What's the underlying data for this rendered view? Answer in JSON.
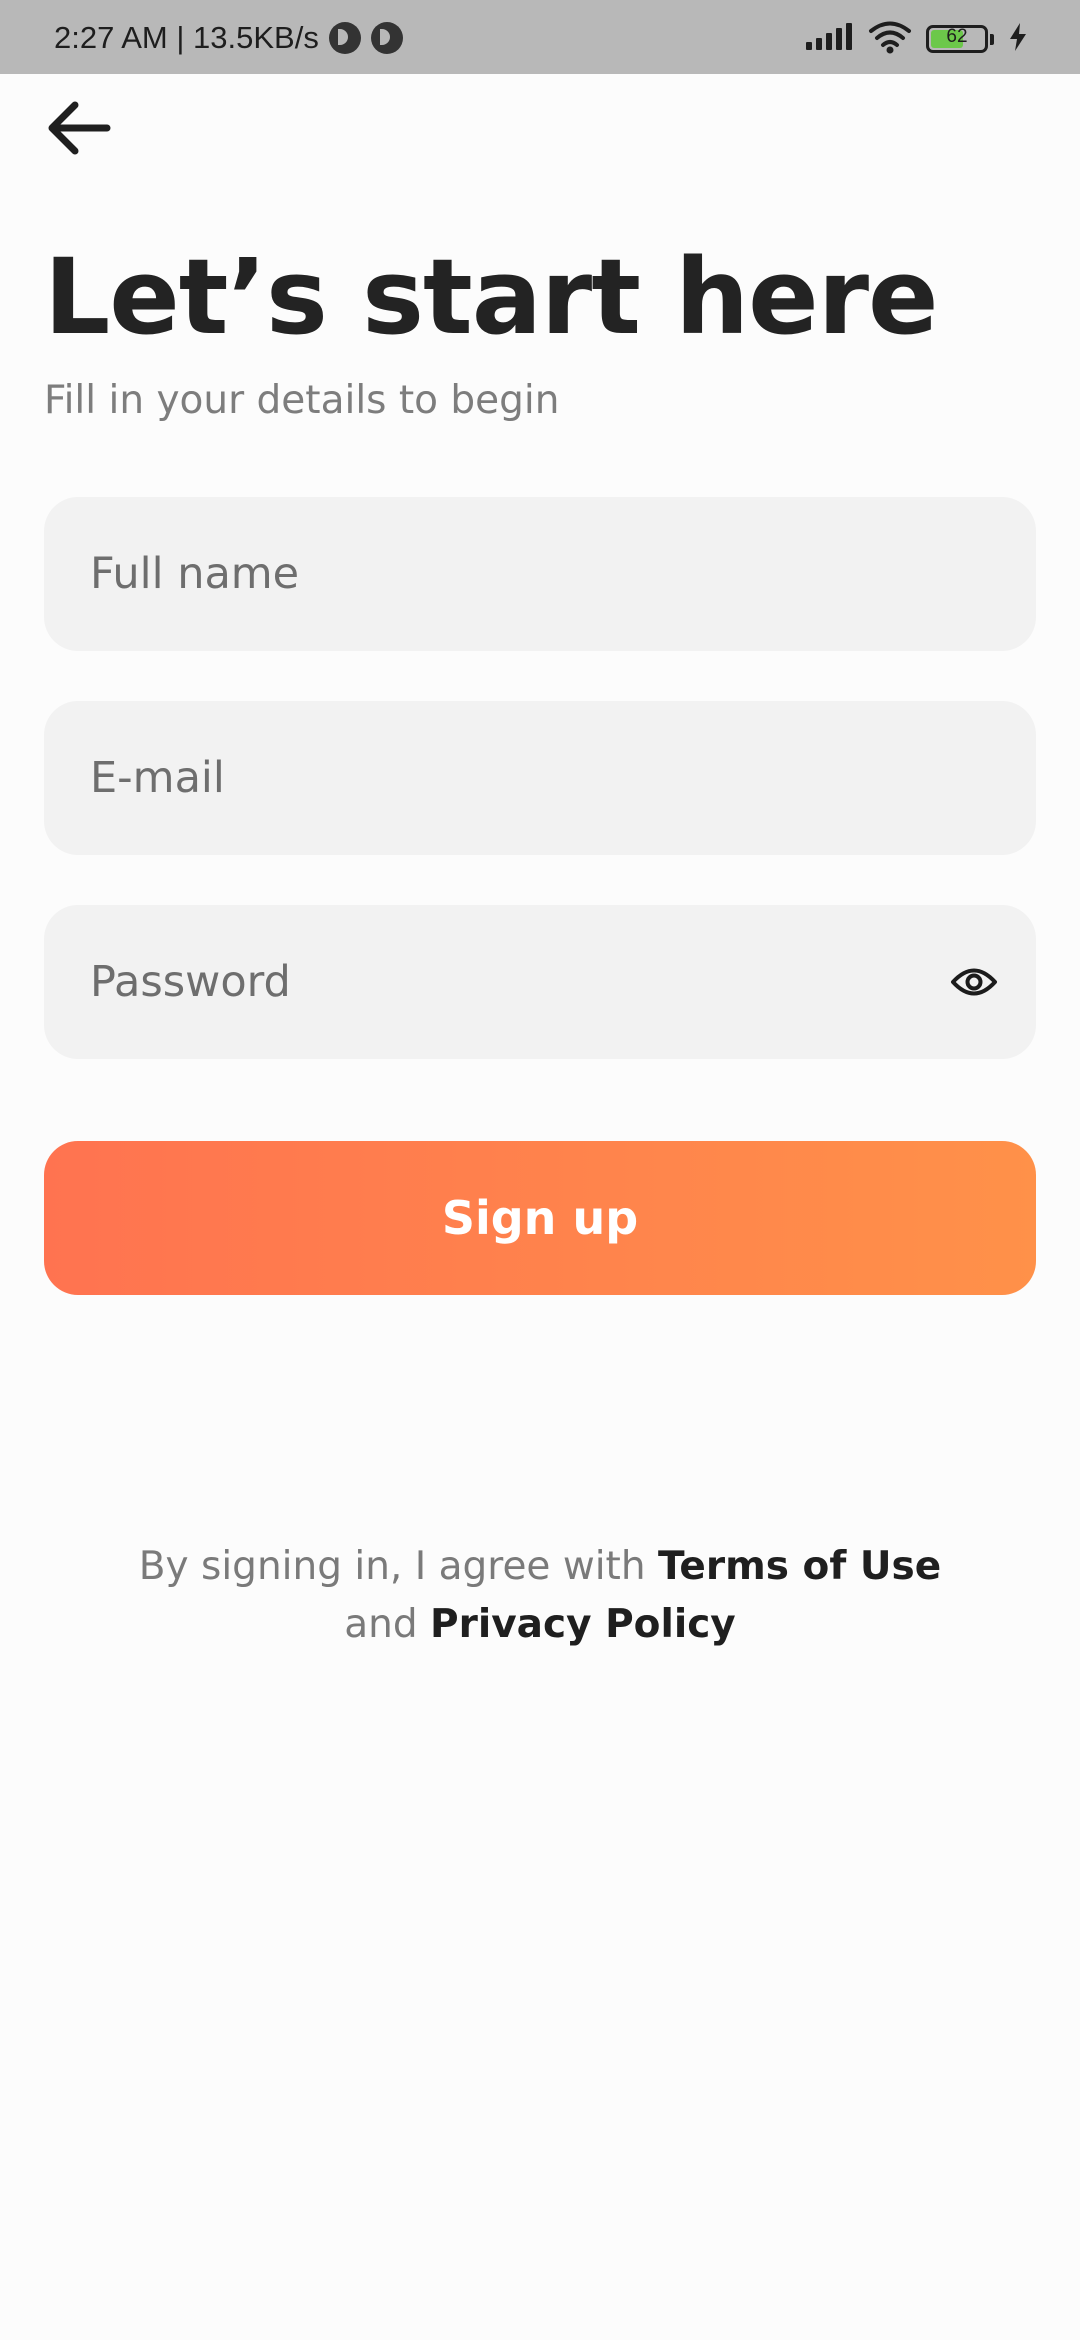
{
  "status_bar": {
    "time_speed": "2:27 AM | 13.5KB/s",
    "battery_level": "62",
    "battery_percent": 62,
    "icons": [
      "app-notification-icon",
      "app-notification-icon",
      "signal-icon",
      "wifi-icon",
      "battery-icon",
      "charging-icon"
    ]
  },
  "header": {
    "back_icon": "arrow-left-icon",
    "title": "Let’s start here",
    "subtitle": "Fill in your details to begin"
  },
  "form": {
    "full_name": {
      "placeholder": "Full name",
      "value": ""
    },
    "email": {
      "placeholder": "E-mail",
      "value": ""
    },
    "password": {
      "placeholder": "Password",
      "value": "",
      "toggle_icon": "eye-icon"
    },
    "submit_label": "Sign up"
  },
  "legal": {
    "prefix": "By signing in, I agree with",
    "terms_link": "Terms of Use",
    "middle": "and",
    "privacy_link": "Privacy Policy"
  },
  "colors": {
    "background": "#fcfcfc",
    "status_bar": "#b8b8b8",
    "field_background": "#f2f2f2",
    "button_gradient_start": "#ff7350",
    "button_gradient_end": "#ff9149",
    "battery_fill": "#6cc84a"
  }
}
